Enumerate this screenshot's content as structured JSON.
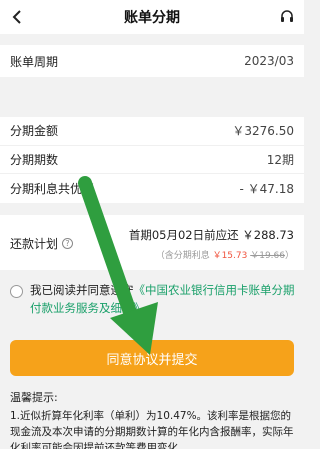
{
  "nav": {
    "title": "账单分期"
  },
  "billing": {
    "label": "账单周期",
    "value": "2023/03"
  },
  "details": [
    {
      "label": "分期金额",
      "value": "￥3276.50"
    },
    {
      "label": "分期期数",
      "value": "12期"
    },
    {
      "label": "分期利息共优惠",
      "value": "- ￥47.18"
    }
  ],
  "plan": {
    "label": "还款计划",
    "main": "首期05月02日前应还 ￥288.73",
    "sub_prefix": "（含分期利息 ",
    "sub_new": "￥15.73",
    "sub_old": "￥19.66",
    "sub_suffix": "）"
  },
  "agreement": {
    "prefix": "我已阅读并同意遵守",
    "link": "《中国农业银行信用卡账单分期付款业务服务及细则》"
  },
  "submit": {
    "label": "同意协议并提交"
  },
  "tips": {
    "title": "温馨提示:",
    "body": "1.近似折算年化利率（单利）为10.47%。该利率是根据您的现金流及本次申请的分期期数计算的年化内含报酬率，实际年化利率可能会因提前还款等费用变化"
  },
  "colors": {
    "accent": "#f6a21a",
    "discount": "#f0543f",
    "link": "#1aa06a",
    "arrow": "#2f9e3f"
  },
  "icons": {
    "back": "chevron-left-icon",
    "service": "headset-icon",
    "help": "question-icon",
    "checkbox": "radio-circle-icon"
  }
}
